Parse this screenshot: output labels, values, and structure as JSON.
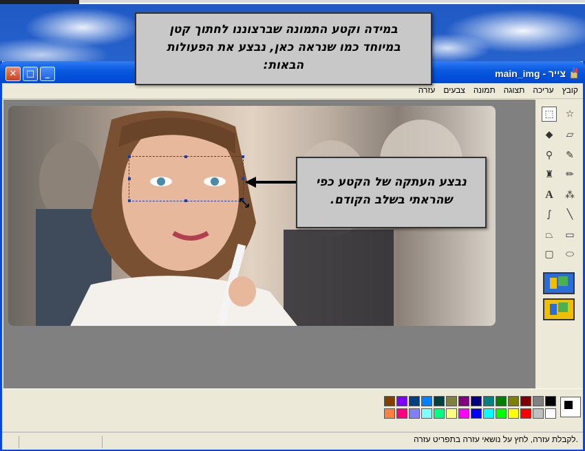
{
  "window": {
    "title": "main_img - צייר"
  },
  "menu": [
    "קובץ",
    "עריכה",
    "תצוגה",
    "תמונה",
    "צבעים",
    "עזרה"
  ],
  "callouts": {
    "top": "במידה וקטע התמונה שברצוננו לחתוך קטן במיוחד כמו שנראה כאן, נבצע את הפעולות הבאות:",
    "side": "נבצע העתקה של הקטע כפי שהראתי בשלב הקודם."
  },
  "status": {
    "text": "לקבלת עזרה, לחץ על נושאי עזרה בתפריט עזרה."
  },
  "tools": [
    "free-select-icon",
    "rect-select-icon",
    "eraser-icon",
    "fill-icon",
    "color-picker-icon",
    "magnifier-icon",
    "pencil-icon",
    "brush-icon",
    "airbrush-icon",
    "text-icon",
    "line-icon",
    "curve-icon",
    "rectangle-icon",
    "polygon-icon",
    "ellipse-icon",
    "rounded-rect-icon"
  ],
  "palette": {
    "row1": [
      "#000000",
      "#808080",
      "#800000",
      "#808000",
      "#008000",
      "#008080",
      "#000080",
      "#800080",
      "#808040",
      "#004040",
      "#0080ff",
      "#004080",
      "#8000ff",
      "#804000"
    ],
    "row2": [
      "#ffffff",
      "#c0c0c0",
      "#ff0000",
      "#ffff00",
      "#00ff00",
      "#00ffff",
      "#0000ff",
      "#ff00ff",
      "#ffff80",
      "#00ff80",
      "#80ffff",
      "#8080ff",
      "#ff0080",
      "#ff8040"
    ],
    "foreground": "#000000",
    "background": "#ffffff"
  }
}
